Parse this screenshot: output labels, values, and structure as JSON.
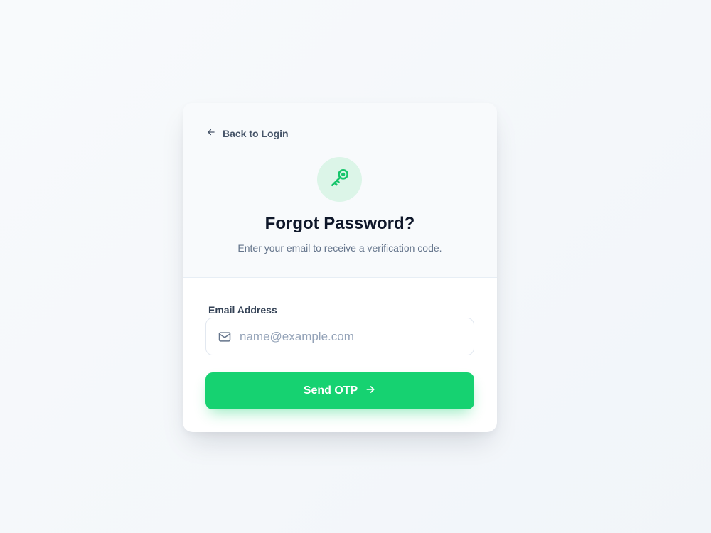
{
  "back_link": {
    "label": "Back to Login",
    "icon": "arrow-left-icon"
  },
  "header": {
    "icon": "key-icon",
    "title": "Forgot Password?",
    "subtitle": "Enter your email to receive a verification code."
  },
  "form": {
    "email": {
      "label": "Email Address",
      "placeholder": "name@example.com",
      "value": "",
      "icon": "mail-icon"
    },
    "submit": {
      "label": "Send OTP",
      "icon": "arrow-right-icon"
    }
  },
  "colors": {
    "accent": "#16d271",
    "accent_soft": "#dcf5e8",
    "title": "#0f172a",
    "muted": "#64748b"
  }
}
